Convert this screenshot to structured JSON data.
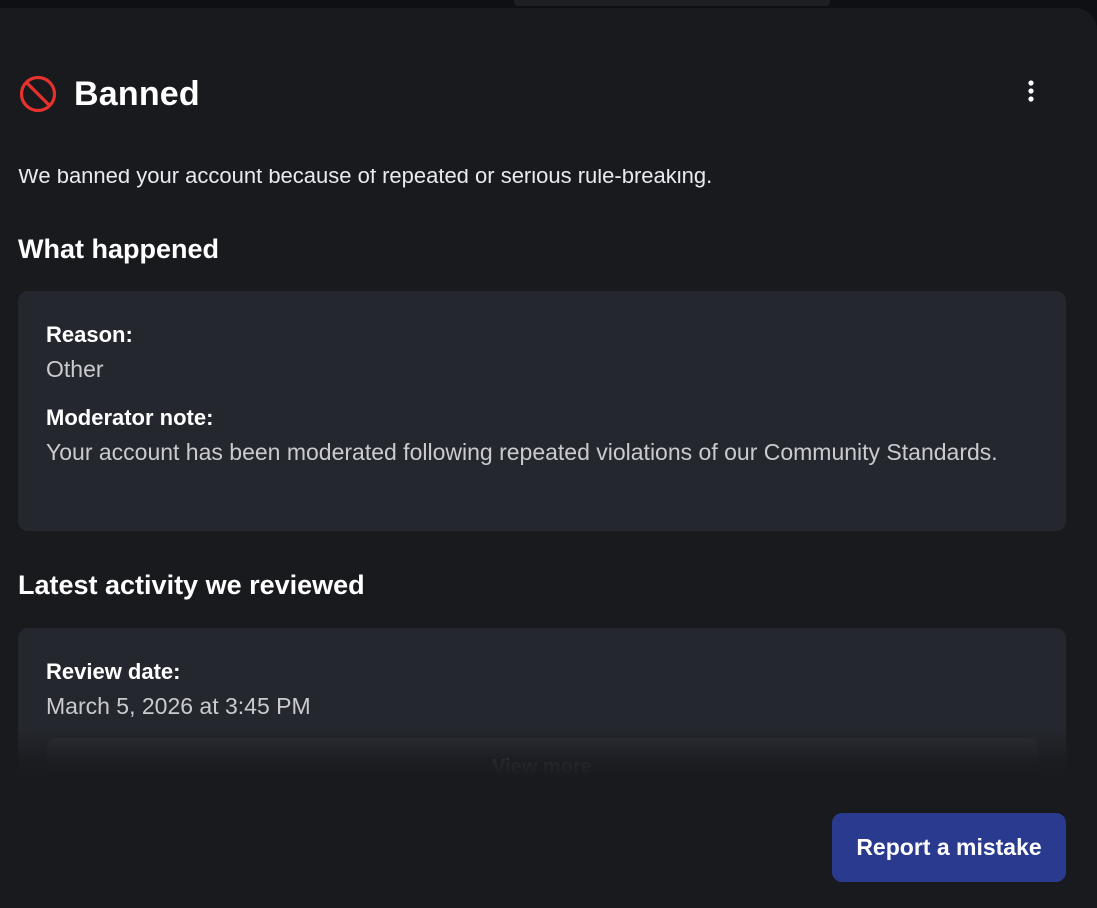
{
  "header": {
    "title": "Banned",
    "icon": "ban-icon",
    "menu_icon": "more-vertical-icon"
  },
  "description": "We banned your account because of repeated or serious rule-breaking.",
  "what_happened": {
    "heading": "What happened",
    "reason_label": "Reason:",
    "reason_value": "Other",
    "note_label": "Moderator note:",
    "note_value": "Your account has been moderated following repeated violations of our Community Standards."
  },
  "latest_activity": {
    "heading": "Latest activity we reviewed",
    "review_date_label": "Review date:",
    "review_date_value": "March 5, 2026 at 3:45 PM",
    "view_more_label": "View more"
  },
  "actions": {
    "report_label": "Report a mistake"
  },
  "colors": {
    "ban_red": "#e5322d",
    "primary_button": "#2a3b8f",
    "card_bg": "#25272e",
    "panel_bg": "#191a1e"
  }
}
